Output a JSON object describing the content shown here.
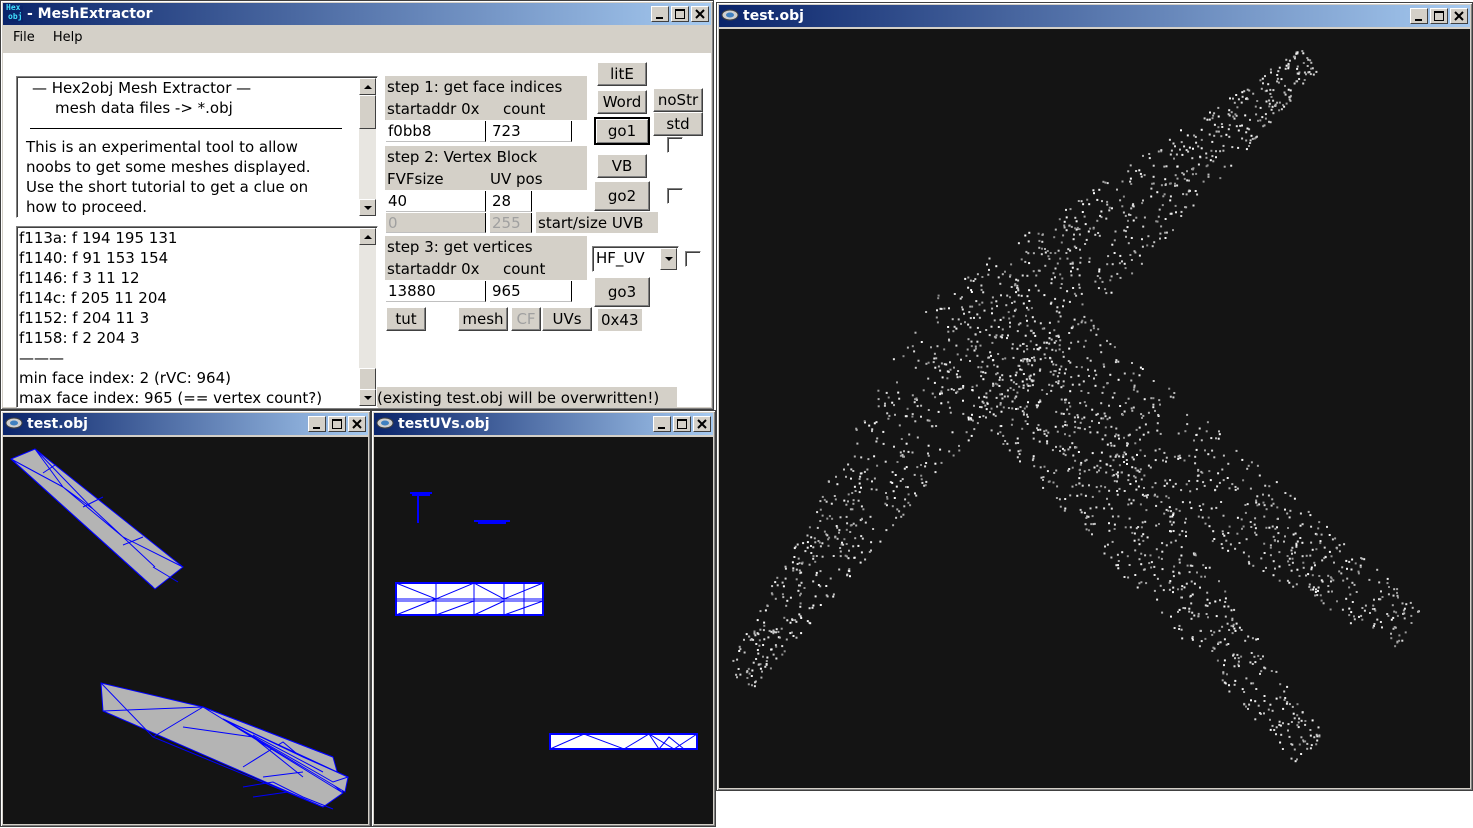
{
  "colors": {
    "titlebar_start": "#0a246a",
    "titlebar_end": "#a6caf0",
    "viewport_bg": "#141414",
    "wire_blue": "#0000ff",
    "mesh_fill": "#b4b4b4"
  },
  "main": {
    "title": "MeshExtractor",
    "title_full": "- MeshExtractor",
    "app_icon_text": [
      "Hex",
      "obj"
    ],
    "menu": {
      "file": "File",
      "help": "Help"
    },
    "info": {
      "heading1": "—   Hex2obj Mesh Extractor   —",
      "heading2": "mesh data files -> *.obj",
      "body": [
        "This is an experimental tool to allow",
        "noobs to get some meshes displayed.",
        "Use the short tutorial to get a clue on",
        "how to proceed."
      ]
    },
    "log": {
      "lines": [
        "f113a: f  194 195 131",
        "f1140: f  91 153 154",
        "f1146: f  3 11 12",
        "f114c: f  205 11 204",
        "f1152: f  204 11 3",
        "f1158: f  2 204 3"
      ],
      "separator": "———",
      "min_line": "min face index: 2  (rVC: 964)",
      "max_line": "max face index: 965 (== vertex count?)"
    },
    "step1": {
      "title": "step 1: get face indices",
      "startaddr_label": "startaddr 0x",
      "count_label": "count",
      "startaddr_value": "f0bb8",
      "count_value": "723"
    },
    "step2": {
      "title": "step 2: Vertex Block",
      "fvf_label": "FVFsize",
      "uvpos_label": "UV pos",
      "fvf_value": "40",
      "uvpos_value": "28",
      "uvb_start": "0",
      "uvb_size": "255",
      "uvb_label": "start/size UVB"
    },
    "step3": {
      "title": "step 3: get vertices",
      "startaddr_label": "startaddr 0x",
      "count_label": "count",
      "startaddr_value": "13880",
      "count_value": "965",
      "format": "HF_UV"
    },
    "buttons": {
      "lite": "litE",
      "word": "Word",
      "nostr": "noStr",
      "std": "std",
      "go1": "go1",
      "vb": "VB",
      "go2": "go2",
      "go3": "go3",
      "tut": "tut",
      "mesh": "mesh",
      "cf": "CF",
      "uvs": "UVs",
      "hex": "0x43"
    },
    "warning": "(existing test.obj will be overwritten!)"
  },
  "viewer_small": {
    "title": "test.obj"
  },
  "viewer_uvs": {
    "title": "testUVs.obj"
  },
  "viewer_large": {
    "title": "test.obj"
  }
}
